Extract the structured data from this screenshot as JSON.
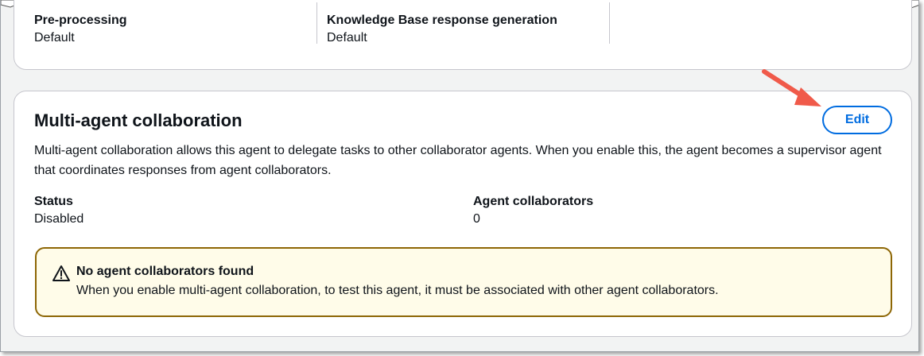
{
  "top_card": {
    "columns": [
      {
        "label": "Pre-processing",
        "value": "Default"
      },
      {
        "label": "Knowledge Base response generation",
        "value": "Default"
      }
    ]
  },
  "collaboration": {
    "title": "Multi-agent collaboration",
    "edit_label": "Edit",
    "description": "Multi-agent collaboration allows this agent to delegate tasks to other collaborator agents. When you enable this, the agent becomes a supervisor agent that coordinates responses from agent collaborators.",
    "status": {
      "label": "Status",
      "value": "Disabled"
    },
    "collaborators": {
      "label": "Agent collaborators",
      "value": "0"
    },
    "alert": {
      "icon": "warning-icon",
      "title": "No agent collaborators found",
      "body": "When you enable multi-agent collaboration, to test this agent, it must be associated with other agent collaborators."
    }
  },
  "colors": {
    "accent": "#006ce0",
    "warning_border": "#8d6605",
    "warning_bg": "#fffce9",
    "annotation_arrow": "#f05a4a"
  }
}
